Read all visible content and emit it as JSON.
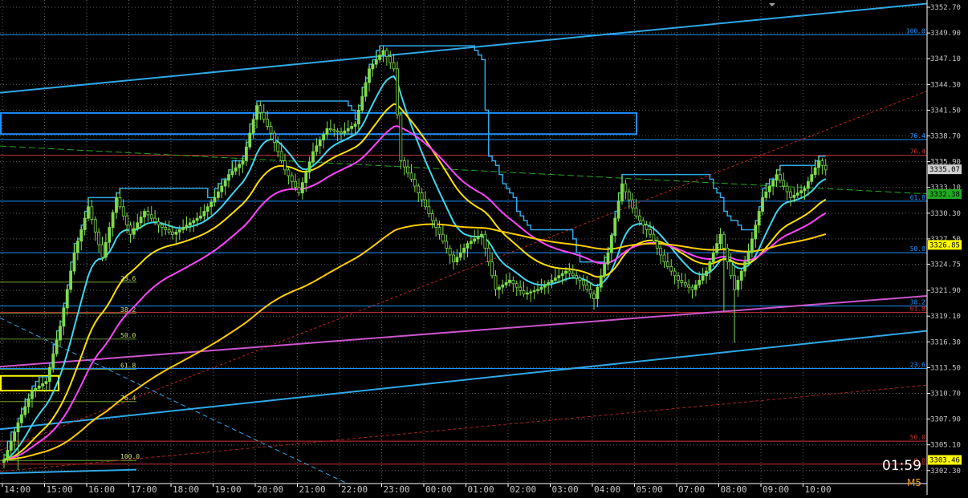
{
  "chart_data": {
    "type": "candlestick",
    "timeframe": "M5",
    "countdown": "01:59",
    "ylim": [
      3300.8,
      3353.4
    ],
    "y_ticks": [
      "3352.70",
      "3349.90",
      "3347.10",
      "3344.30",
      "3341.50",
      "3338.70",
      "3335.90",
      "3333.10",
      "3330.30",
      "3327.50",
      "3324.75",
      "3321.90",
      "3319.10",
      "3316.30",
      "3313.50",
      "3310.70",
      "3307.90",
      "3305.10",
      "3302.30"
    ],
    "x_ticks": [
      "14:00",
      "15:00",
      "16:00",
      "17:00",
      "18:00",
      "19:00",
      "20:00",
      "21:00",
      "22:00",
      "23:00",
      "00:00",
      "01:00",
      "02:00",
      "03:00",
      "04:00",
      "05:00",
      "07:00",
      "08:00",
      "09:00",
      "10:00"
    ],
    "price_labels": [
      {
        "text": "3335.07",
        "value": 3335.07,
        "bg": "#cfcfcf",
        "fg": "#000000"
      },
      {
        "text": "3332.38",
        "value": 3332.38,
        "bg": "#22aa22",
        "fg": "#000000"
      },
      {
        "text": "3326.85",
        "value": 3326.85,
        "bg": "#ffff00",
        "fg": "#000000"
      },
      {
        "text": "3303.46",
        "value": 3303.46,
        "bg": "#ffff00",
        "fg": "#000000"
      }
    ],
    "fib_right_levels": [
      {
        "label": "100.0",
        "value": 3349.7,
        "color": "#1e90ff"
      },
      {
        "label": "76.4",
        "value": 3338.3,
        "color": "#1e90ff"
      },
      {
        "label": "76.4",
        "value": 3336.6,
        "color": "#cc3333"
      },
      {
        "label": "61.8",
        "value": 3331.6,
        "color": "#1e90ff"
      },
      {
        "label": "50.0",
        "value": 3326.0,
        "color": "#1e90ff"
      },
      {
        "label": "38.2",
        "value": 3320.2,
        "color": "#1e90ff"
      },
      {
        "label": "61.8",
        "value": 3319.5,
        "color": "#cc3333"
      },
      {
        "label": "23.6",
        "value": 3313.4,
        "color": "#1e90ff"
      },
      {
        "label": "50.0",
        "value": 3305.5,
        "color": "#cc3333"
      },
      {
        "label": "0.0",
        "value": 3303.0,
        "color": "#cc3333"
      }
    ],
    "fib_left_levels": [
      {
        "label": "23.6",
        "value": 3322.8
      },
      {
        "label": "38.2",
        "value": 3319.4
      },
      {
        "label": "50.0",
        "value": 3316.6
      },
      {
        "label": "61.8",
        "value": 3313.3
      },
      {
        "label": "76.4",
        "value": 3309.8
      },
      {
        "label": "100.0",
        "value": 3303.4
      }
    ],
    "colors": {
      "background": "#000000",
      "grid": "#5f5f5f",
      "candle": "#7fdc4a",
      "ema_fast": "#3dd6f0",
      "ema_mid": "#ff44ff",
      "ema_slow": "#ffe000",
      "fib_blue": "#1e90ff",
      "fib_red": "#cc3333",
      "axis_text": "#c8c8c8"
    }
  }
}
